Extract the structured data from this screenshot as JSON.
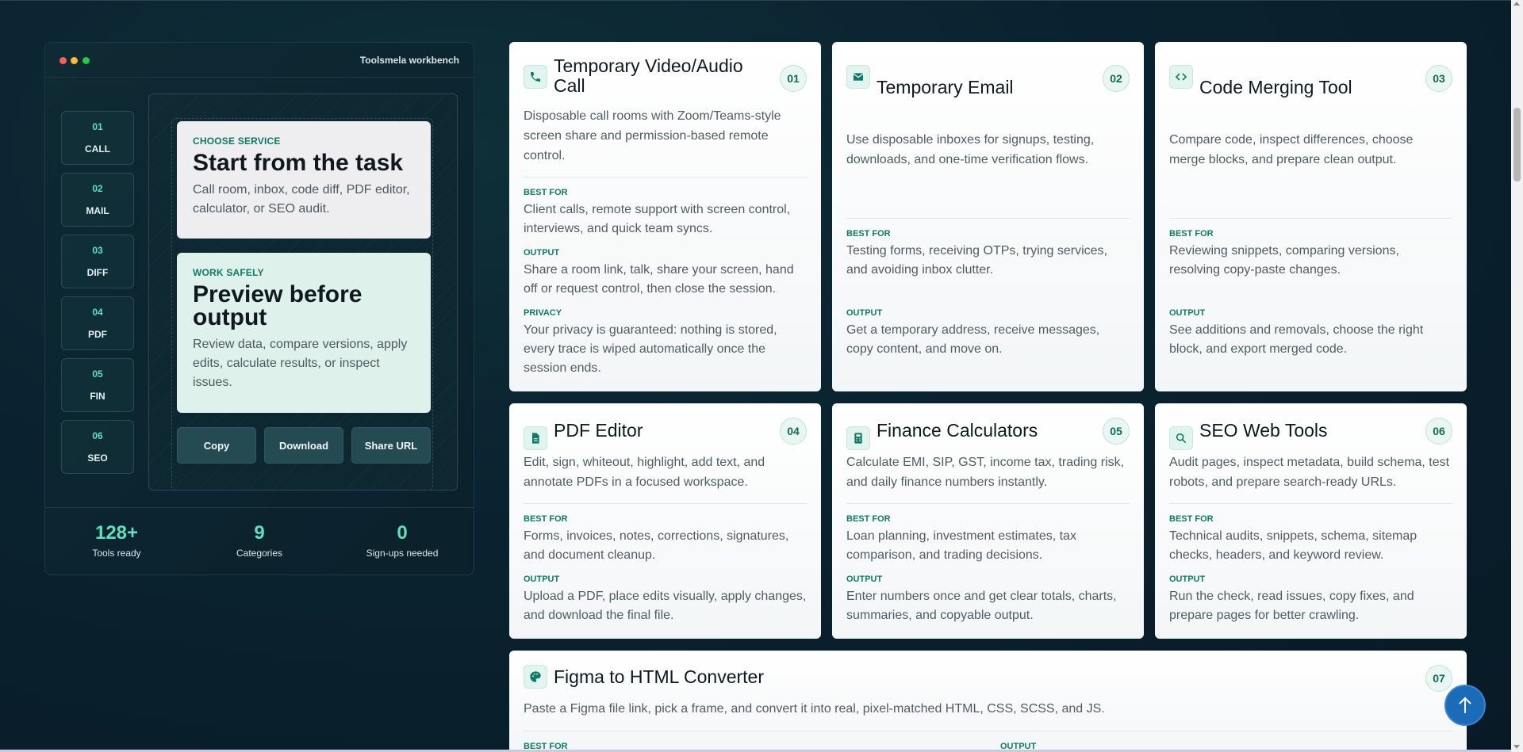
{
  "workbench": {
    "title": "Toolsmela workbench",
    "nav": [
      {
        "num": "01",
        "label": "CALL"
      },
      {
        "num": "02",
        "label": "MAIL"
      },
      {
        "num": "03",
        "label": "DIFF"
      },
      {
        "num": "04",
        "label": "PDF"
      },
      {
        "num": "05",
        "label": "FIN"
      },
      {
        "num": "06",
        "label": "SEO"
      }
    ],
    "choose": {
      "eyebrow": "CHOOSE SERVICE",
      "heading": "Start from the task",
      "text": "Call room, inbox, code diff, PDF editor, calculator, or SEO audit."
    },
    "safe": {
      "eyebrow": "WORK SAFELY",
      "heading": "Preview before output",
      "text": "Review data, compare versions, apply edits, calculate results, or inspect issues."
    },
    "actions": {
      "copy": "Copy",
      "download": "Download",
      "share": "Share URL"
    },
    "stats": [
      {
        "num": "128+",
        "label": "Tools ready"
      },
      {
        "num": "9",
        "label": "Categories"
      },
      {
        "num": "0",
        "label": "Sign-ups needed"
      }
    ]
  },
  "tools": [
    {
      "num": "01",
      "icon": "phone-icon",
      "title": "Temporary Video/Audio Call",
      "desc": "Disposable call rooms with Zoom/Teams-style screen share and permission-based remote control.",
      "best_for_label": "BEST FOR",
      "best_for": "Client calls, remote support with screen control, interviews, and quick team syncs.",
      "output_label": "OUTPUT",
      "output": "Share a room link, talk, share your screen, hand off or request control, then close the session.",
      "privacy_label": "PRIVACY",
      "privacy": "Your privacy is guaranteed: nothing is stored, every trace is wiped automatically once the session ends."
    },
    {
      "num": "02",
      "icon": "mail-icon",
      "title": "Temporary Email",
      "desc": "Use disposable inboxes for signups, testing, downloads, and one-time verification flows.",
      "best_for_label": "BEST FOR",
      "best_for": "Testing forms, receiving OTPs, trying services, and avoiding inbox clutter.",
      "output_label": "OUTPUT",
      "output": "Get a temporary address, receive messages, copy content, and move on."
    },
    {
      "num": "03",
      "icon": "code-icon",
      "title": "Code Merging Tool",
      "desc": "Compare code, inspect differences, choose merge blocks, and prepare clean output.",
      "best_for_label": "BEST FOR",
      "best_for": "Reviewing snippets, comparing versions, resolving copy-paste changes.",
      "output_label": "OUTPUT",
      "output": "See additions and removals, choose the right block, and export merged code."
    },
    {
      "num": "04",
      "icon": "document-icon",
      "title": "PDF Editor",
      "desc": "Edit, sign, whiteout, highlight, add text, and annotate PDFs in a focused workspace.",
      "best_for_label": "BEST FOR",
      "best_for": "Forms, invoices, notes, corrections, signatures, and document cleanup.",
      "output_label": "OUTPUT",
      "output": "Upload a PDF, place edits visually, apply changes, and download the final file."
    },
    {
      "num": "05",
      "icon": "calculator-icon",
      "title": "Finance Calculators",
      "desc": "Calculate EMI, SIP, GST, income tax, trading risk, and daily finance numbers instantly.",
      "best_for_label": "BEST FOR",
      "best_for": "Loan planning, investment estimates, tax comparison, and trading decisions.",
      "output_label": "OUTPUT",
      "output": "Enter numbers once and get clear totals, charts, summaries, and copyable output."
    },
    {
      "num": "06",
      "icon": "search-icon",
      "title": "SEO Web Tools",
      "desc": "Audit pages, inspect metadata, build schema, test robots, and prepare search-ready URLs.",
      "best_for_label": "BEST FOR",
      "best_for": "Technical audits, snippets, schema, sitemap checks, headers, and keyword review.",
      "output_label": "OUTPUT",
      "output": "Run the check, read issues, copy fixes, and prepare pages for better crawling."
    },
    {
      "num": "07",
      "icon": "palette-icon",
      "title": "Figma to HTML Converter",
      "desc": "Paste a Figma file link, pick a frame, and convert it into real, pixel-matched HTML, CSS, SCSS, and JS.",
      "best_for_label": "BEST FOR",
      "output_label": "OUTPUT"
    }
  ],
  "back_to_top": "↑",
  "colors": {
    "accent": "#0f7a66",
    "stat": "#5ee0c0",
    "back_to_top": "#1c6bb8"
  }
}
